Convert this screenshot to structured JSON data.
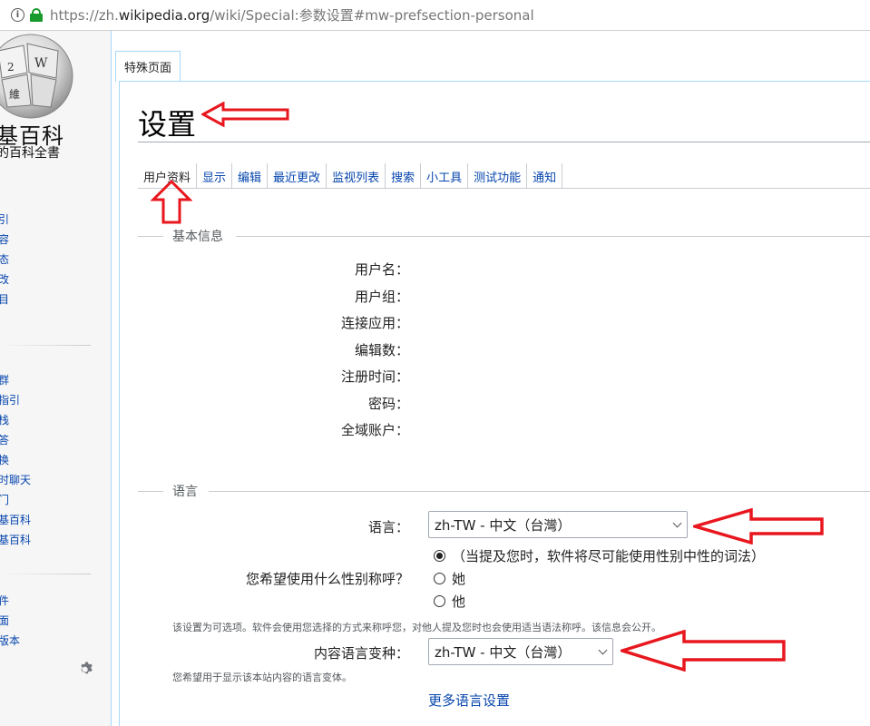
{
  "browser": {
    "url_prefix": "https://zh.",
    "url_domain": "wikipedia.org",
    "url_path": "/wiki/Special:参数设置#mw-prefsection-personal",
    "info_icon": "i"
  },
  "sidebar": {
    "logo_line1": "基百科",
    "logo_line2": "的百科全書",
    "links_group1": [
      "引",
      "容",
      "态",
      "改",
      "目"
    ],
    "links_group2": [
      "群",
      "指引",
      "栈",
      "答",
      "换",
      "时聊天",
      "门",
      "基百科",
      "基百科"
    ],
    "links_group3": [
      "件",
      "面",
      "版本"
    ],
    "gear_icon": "gear-icon"
  },
  "page": {
    "namespace_tab": "特殊页面",
    "title": "设置",
    "pref_tabs": [
      "用户资料",
      "显示",
      "编辑",
      "最近更改",
      "监视列表",
      "搜索",
      "小工具",
      "测试功能",
      "通知"
    ]
  },
  "basic_info": {
    "legend": "基本信息",
    "labels": [
      "用户名：",
      "用户组：",
      "连接应用：",
      "编辑数：",
      "注册时间：",
      "密码：",
      "全域账户："
    ]
  },
  "language_section": {
    "legend": "语言",
    "language_label": "语言：",
    "language_value": "zh-TW - 中文（台灣）",
    "gender_label": "您希望使用什么性别称呼？",
    "gender_options": [
      "（当提及您时，软件将尽可能使用性别中性的词法）",
      "她",
      "他"
    ],
    "gender_selected": 0,
    "gender_help": "该设置为可选项。软件会使用您选择的方式来称呼您，对他人提及您时也会使用适当语法称呼。该信息会公开。",
    "variant_label": "内容语言变种：",
    "variant_value": "zh-TW - 中文（台灣）",
    "variant_help": "您希望用于显示该本站内容的语言变体。",
    "more_link": "更多语言设置"
  },
  "annotation_color": "#e8171e"
}
